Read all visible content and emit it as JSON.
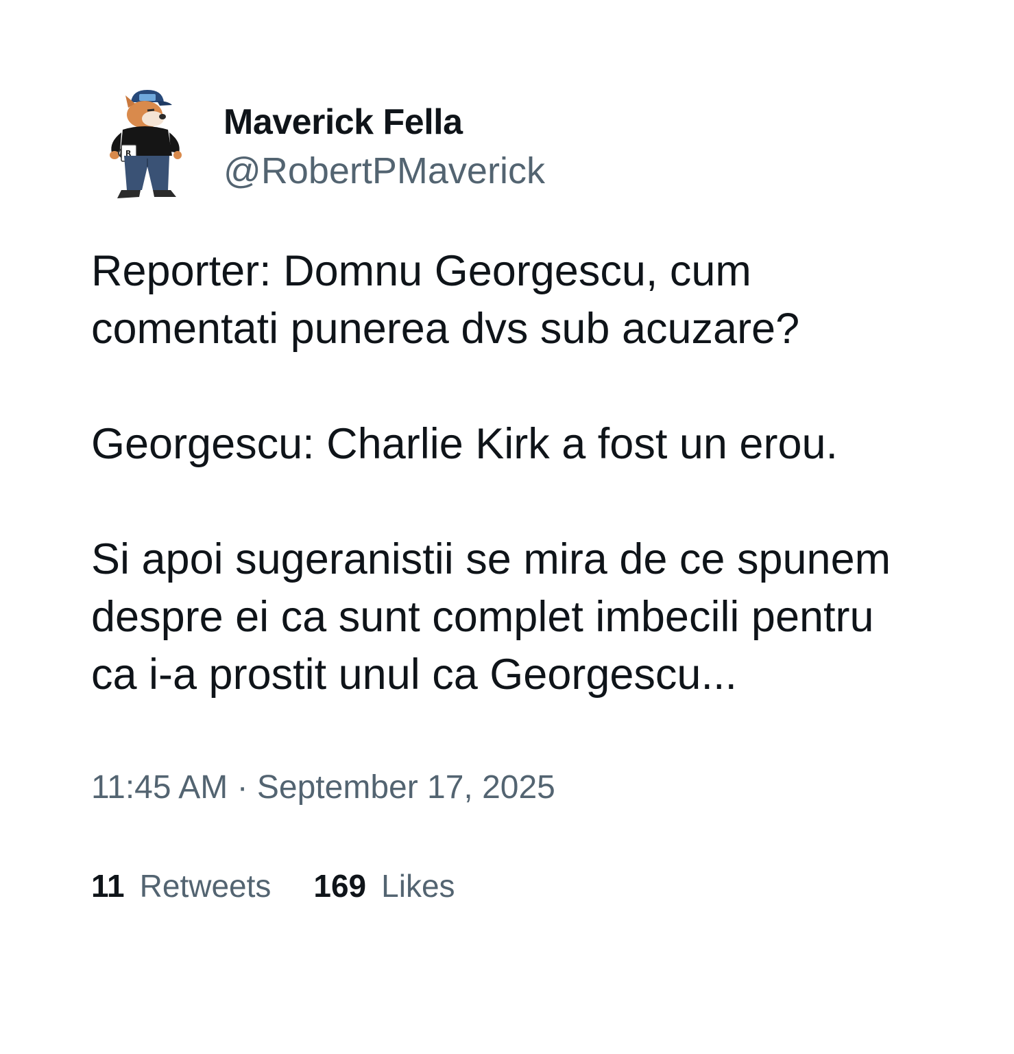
{
  "author": {
    "display_name": "Maverick Fella",
    "handle": "@RobertPMaverick",
    "avatar_icon": "dog-character-avatar-icon"
  },
  "tweet": {
    "paragraphs": [
      "Reporter: Domnu Georgescu, cum comentati punerea dvs sub acuzare?",
      "Georgescu: Charlie Kirk a fost un erou.",
      "Si apoi sugeranistii se mira de ce spunem despre ei ca sunt complet imbecili pentru ca i-a prostit unul ca Georgescu..."
    ],
    "timestamp": "11:45 AM · September 17, 2025"
  },
  "stats": {
    "retweets_count": "11",
    "retweets_label": "Retweets",
    "likes_count": "169",
    "likes_label": "Likes"
  },
  "colors": {
    "text_primary": "#0f1419",
    "text_secondary": "#536471",
    "background": "#ffffff"
  }
}
